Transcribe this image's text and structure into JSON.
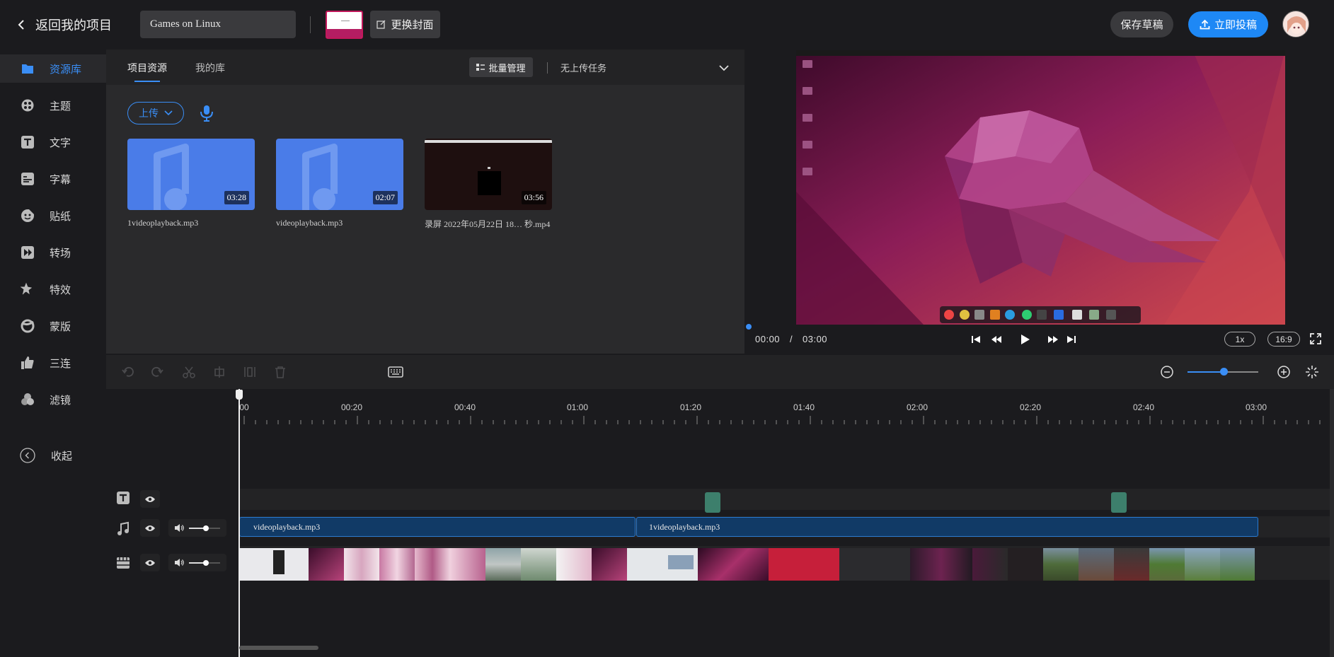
{
  "topbar": {
    "back_label": "返回我的项目",
    "project_title": "Games on Linux",
    "change_cover_label": "更换封面",
    "save_draft_label": "保存草稿",
    "publish_label": "立即投稿"
  },
  "sidebar": {
    "items": [
      {
        "label": "资源库",
        "icon": "folder-icon",
        "active": true
      },
      {
        "label": "主题",
        "icon": "theme-icon"
      },
      {
        "label": "文字",
        "icon": "text-icon"
      },
      {
        "label": "字幕",
        "icon": "subtitle-icon"
      },
      {
        "label": "贴纸",
        "icon": "sticker-icon"
      },
      {
        "label": "转场",
        "icon": "transition-icon"
      },
      {
        "label": "特效",
        "icon": "effects-icon"
      },
      {
        "label": "蒙版",
        "icon": "mask-icon"
      },
      {
        "label": "三连",
        "icon": "thumbs-up-icon"
      },
      {
        "label": "滤镜",
        "icon": "filter-icon"
      }
    ],
    "collapse_label": "收起"
  },
  "resources": {
    "tabs": [
      {
        "label": "项目资源",
        "active": true
      },
      {
        "label": "我的库",
        "active": false
      }
    ],
    "batch_manage_label": "批量管理",
    "upload_status": "无上传任务",
    "upload_label": "上传",
    "media": [
      {
        "name": "1videoplayback.mp3",
        "duration": "03:28",
        "kind": "audio"
      },
      {
        "name": "videoplayback.mp3",
        "duration": "02:07",
        "kind": "audio"
      },
      {
        "name": "录屏 2022年05月22日 18… 秒.mp4",
        "duration": "03:56",
        "kind": "video"
      }
    ]
  },
  "preview": {
    "current_time": "00:00",
    "separator": "/",
    "total_time": "03:00",
    "speed": "1x",
    "ratio": "16:9"
  },
  "timeline": {
    "ruler_labels": [
      "00",
      "00:20",
      "00:40",
      "01:00",
      "01:20",
      "01:40",
      "02:00",
      "02:20",
      "02:40",
      "03:00"
    ],
    "audio_clips": [
      {
        "name": "videoplayback.mp3"
      },
      {
        "name": "1videoplayback.mp3"
      }
    ],
    "zoom_level": 0.46
  },
  "colors": {
    "accent": "#3a8ef6",
    "publish": "#1e88f5",
    "text_clip": "#3d7f6c",
    "audio_clip": "#113a66",
    "audio_thumb": "#4a7ce8"
  }
}
